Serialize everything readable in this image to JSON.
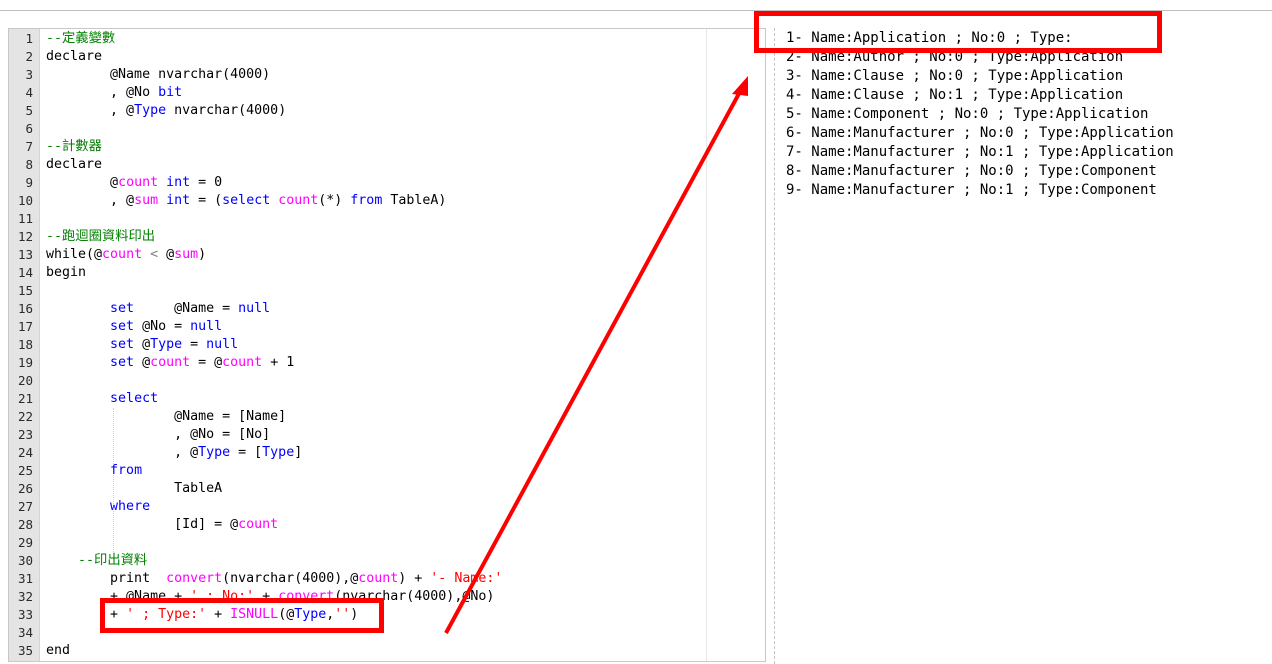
{
  "editor": {
    "lines": [
      {
        "n": "1",
        "parts": [
          [
            "cm",
            "--定義變數"
          ]
        ]
      },
      {
        "n": "2",
        "parts": [
          [
            "var",
            "declare"
          ]
        ]
      },
      {
        "n": "3",
        "parts": [
          [
            "var",
            "        @Name nvarchar("
          ],
          [
            "var",
            "4000"
          ],
          [
            "var",
            ")"
          ]
        ]
      },
      {
        "n": "4",
        "parts": [
          [
            "var",
            "        , @No "
          ],
          [
            "typ",
            "bit"
          ]
        ]
      },
      {
        "n": "5",
        "parts": [
          [
            "var",
            "        , @"
          ],
          [
            "kw",
            "Type"
          ],
          [
            "var",
            " nvarchar("
          ],
          [
            "var",
            "4000"
          ],
          [
            "var",
            ")"
          ]
        ]
      },
      {
        "n": "6",
        "parts": [
          [
            "var",
            ""
          ]
        ]
      },
      {
        "n": "7",
        "parts": [
          [
            "cm",
            "--計數器"
          ]
        ]
      },
      {
        "n": "8",
        "parts": [
          [
            "var",
            "declare"
          ]
        ]
      },
      {
        "n": "9",
        "parts": [
          [
            "var",
            "        @"
          ],
          [
            "fn",
            "count"
          ],
          [
            "var",
            " "
          ],
          [
            "typ",
            "int"
          ],
          [
            "var",
            " = 0"
          ]
        ]
      },
      {
        "n": "10",
        "parts": [
          [
            "var",
            "        , @"
          ],
          [
            "fn",
            "sum"
          ],
          [
            "var",
            " "
          ],
          [
            "typ",
            "int"
          ],
          [
            "var",
            " = ("
          ],
          [
            "kw",
            "select"
          ],
          [
            "var",
            " "
          ],
          [
            "fn",
            "count"
          ],
          [
            "var",
            "(*) "
          ],
          [
            "kw",
            "from"
          ],
          [
            "var",
            " TableA)"
          ]
        ]
      },
      {
        "n": "11",
        "parts": [
          [
            "var",
            ""
          ]
        ]
      },
      {
        "n": "12",
        "parts": [
          [
            "cm",
            "--跑迴圈資料印出"
          ]
        ]
      },
      {
        "n": "13",
        "parts": [
          [
            "var",
            "while(@"
          ],
          [
            "fn",
            "count"
          ],
          [
            "op",
            " < "
          ],
          [
            "var",
            "@"
          ],
          [
            "fn",
            "sum"
          ],
          [
            "var",
            ")"
          ]
        ]
      },
      {
        "n": "14",
        "parts": [
          [
            "var",
            "begin"
          ]
        ]
      },
      {
        "n": "15",
        "parts": [
          [
            "var",
            ""
          ]
        ]
      },
      {
        "n": "16",
        "parts": [
          [
            "var",
            "        "
          ],
          [
            "kw",
            "set"
          ],
          [
            "var",
            "     @Name = "
          ],
          [
            "kw",
            "null"
          ]
        ]
      },
      {
        "n": "17",
        "parts": [
          [
            "var",
            "        "
          ],
          [
            "kw",
            "set"
          ],
          [
            "var",
            " @No = "
          ],
          [
            "kw",
            "null"
          ]
        ]
      },
      {
        "n": "18",
        "parts": [
          [
            "var",
            "        "
          ],
          [
            "kw",
            "set"
          ],
          [
            "var",
            " @"
          ],
          [
            "kw",
            "Type"
          ],
          [
            "var",
            " = "
          ],
          [
            "kw",
            "null"
          ]
        ]
      },
      {
        "n": "19",
        "parts": [
          [
            "var",
            "        "
          ],
          [
            "kw",
            "set"
          ],
          [
            "var",
            " @"
          ],
          [
            "fn",
            "count"
          ],
          [
            "var",
            " = @"
          ],
          [
            "fn",
            "count"
          ],
          [
            "var",
            " + 1"
          ]
        ]
      },
      {
        "n": "20",
        "parts": [
          [
            "var",
            ""
          ]
        ]
      },
      {
        "n": "21",
        "parts": [
          [
            "var",
            "        "
          ],
          [
            "kw",
            "select"
          ]
        ]
      },
      {
        "n": "22",
        "parts": [
          [
            "var",
            "                @Name = [Name]"
          ]
        ]
      },
      {
        "n": "23",
        "parts": [
          [
            "var",
            "                , @No = [No]"
          ]
        ]
      },
      {
        "n": "24",
        "parts": [
          [
            "var",
            "                , @"
          ],
          [
            "kw",
            "Type"
          ],
          [
            "var",
            " = ["
          ],
          [
            "kw",
            "Type"
          ],
          [
            "var",
            "]"
          ]
        ]
      },
      {
        "n": "25",
        "parts": [
          [
            "var",
            "        "
          ],
          [
            "kw",
            "from"
          ]
        ]
      },
      {
        "n": "26",
        "parts": [
          [
            "var",
            "                TableA"
          ]
        ]
      },
      {
        "n": "27",
        "parts": [
          [
            "var",
            "        "
          ],
          [
            "kw",
            "where"
          ]
        ]
      },
      {
        "n": "28",
        "parts": [
          [
            "var",
            "                [Id] = @"
          ],
          [
            "fn",
            "count"
          ]
        ]
      },
      {
        "n": "29",
        "parts": [
          [
            "var",
            ""
          ]
        ]
      },
      {
        "n": "30",
        "parts": [
          [
            "var",
            "    "
          ],
          [
            "cm",
            "--印出資料"
          ]
        ]
      },
      {
        "n": "31",
        "parts": [
          [
            "var",
            "        print  "
          ],
          [
            "fn",
            "convert"
          ],
          [
            "var",
            "(nvarchar(4000),@"
          ],
          [
            "fn",
            "count"
          ],
          [
            "var",
            ") + "
          ],
          [
            "str",
            "'- Name:'"
          ]
        ]
      },
      {
        "n": "32",
        "parts": [
          [
            "var",
            "        + @Name + "
          ],
          [
            "str",
            "' ; No:'"
          ],
          [
            "var",
            " + "
          ],
          [
            "fn",
            "convert"
          ],
          [
            "var",
            "(nvarchar(4000),@No)"
          ]
        ]
      },
      {
        "n": "33",
        "parts": [
          [
            "var",
            "        + "
          ],
          [
            "str",
            "' ; Type:'"
          ],
          [
            "var",
            " + "
          ],
          [
            "fn",
            "ISNULL"
          ],
          [
            "var",
            "(@"
          ],
          [
            "kw",
            "Type"
          ],
          [
            "var",
            ","
          ],
          [
            "str",
            "''"
          ],
          [
            "var",
            ")"
          ]
        ]
      },
      {
        "n": "34",
        "parts": [
          [
            "var",
            ""
          ]
        ]
      },
      {
        "n": "35",
        "parts": [
          [
            "var",
            "end"
          ]
        ]
      }
    ]
  },
  "output": {
    "lines": [
      "1- Name:Application ; No:0 ; Type:",
      "2- Name:Author ; No:0 ; Type:Application",
      "3- Name:Clause ; No:0 ; Type:Application",
      "4- Name:Clause ; No:1 ; Type:Application",
      "5- Name:Component ; No:0 ; Type:Application",
      "6- Name:Manufacturer ; No:0 ; Type:Application",
      "7- Name:Manufacturer ; No:1 ; Type:Application",
      "8- Name:Manufacturer ; No:0 ; Type:Component",
      "9- Name:Manufacturer ; No:1 ; Type:Component"
    ]
  },
  "colors": {
    "keyword": "#0000ff",
    "function": "#ff00ff",
    "string": "#ff0000",
    "comment": "#008000",
    "annotation": "#ff0000"
  }
}
